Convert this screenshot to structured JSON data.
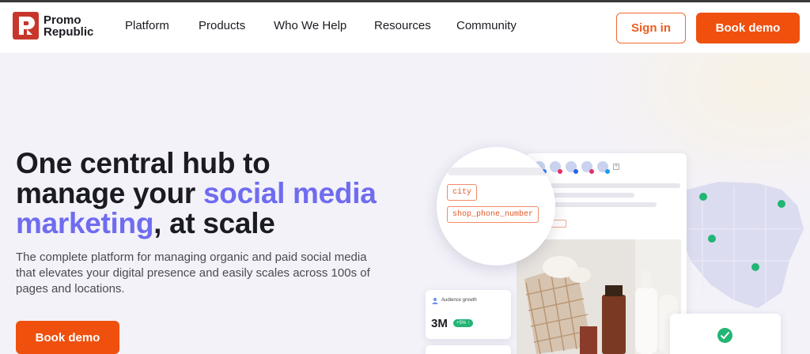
{
  "brand": {
    "name_line1": "Promo",
    "name_line2": "Republic",
    "color": "#c8362b"
  },
  "nav": {
    "items": [
      "Platform",
      "Products",
      "Who We Help",
      "Resources",
      "Community"
    ],
    "sign_in": "Sign in",
    "book_demo": "Book demo"
  },
  "hero": {
    "headline_1": "One central hub to",
    "headline_2a": "manage your ",
    "headline_2b": "social media",
    "headline_3a": "marketing",
    "headline_3b": ", at scale",
    "subtext": "The complete platform for managing organic and paid social media that elevates your digital presence and easily scales across 100s of pages and locations.",
    "cta": "Book demo"
  },
  "illustration": {
    "tags": [
      "city",
      "shop_phone_number"
    ],
    "audience_title": "Audience growth",
    "audience_value": "3M",
    "audience_change": "+5% ↑"
  },
  "colors": {
    "accent": "#6f6cf0",
    "cta": "#f0500e",
    "success": "#22b573"
  }
}
